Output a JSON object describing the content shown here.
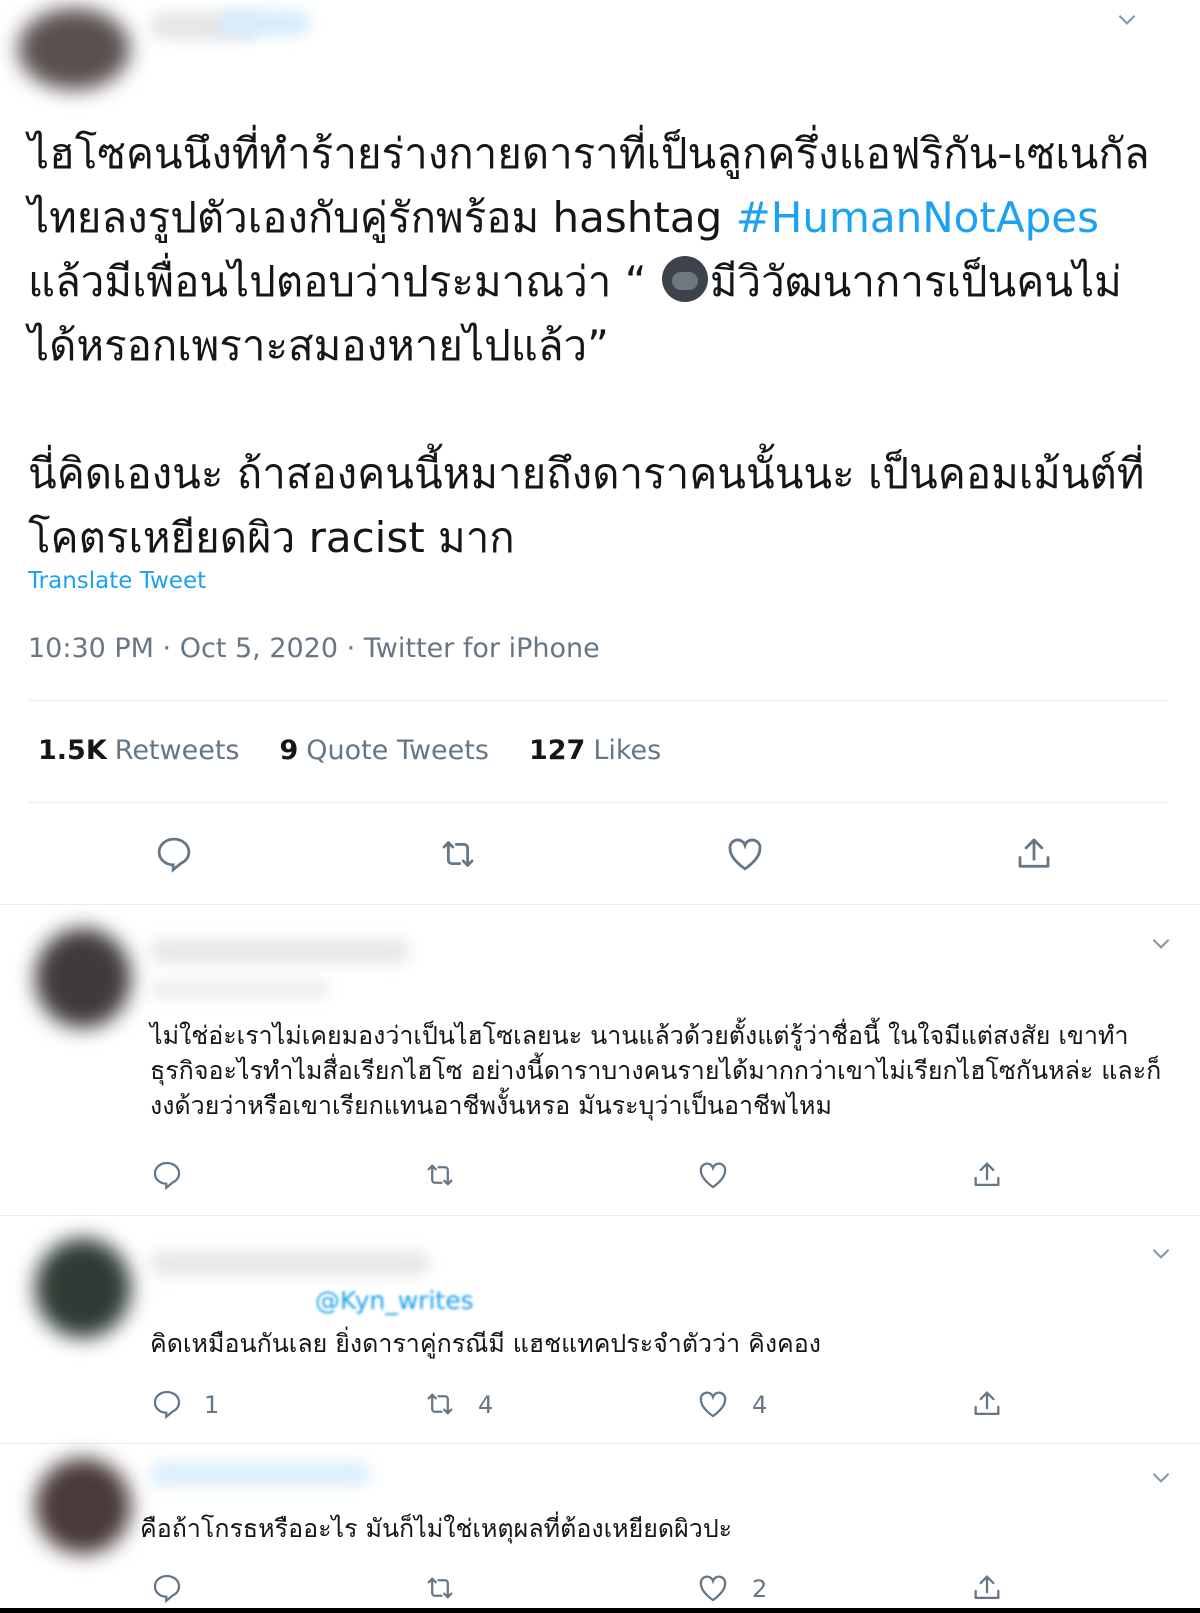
{
  "tweet": {
    "text": {
      "line_part1": "ไฮโซคนนึงที่ทำร้ายร่างกายดาราที่เป็นลูกครึ่งแอฟริกัน-เซเนกัล ไทยลงรูปตัวเองกับคู่รักพร้อม hashtag ",
      "hashtag": "#HumanNotApes",
      "line_part2": " แล้วมีเพื่อนไปตอบว่าประมาณว่า “ ",
      "line_part3": "มีวิวัฒนาการเป็นคนไม่ได้หรอกเพราะสมองหายไปแล้ว”",
      "paragraph2": "นี่คิดเองนะ ถ้าสองคนนี้หมายถึงดาราคนนั้นนะ เป็นคอมเม้นต์ที่โคตรเหยียดผิว racist มาก"
    },
    "translate_label": "Translate Tweet",
    "time": "10:30 PM · Oct 5, 2020 · Twitter for iPhone",
    "stats": [
      {
        "count": "1.5K",
        "label": "Retweets"
      },
      {
        "count": "9",
        "label": "Quote Tweets"
      },
      {
        "count": "127",
        "label": "Likes"
      }
    ],
    "icons": [
      "reply-icon",
      "retweet-icon",
      "like-icon",
      "share-icon"
    ]
  },
  "replies": [
    {
      "text": "ไม่ใช่อ่ะเราไม่เคยมองว่าเป็นไฮโซเลยนะ นานแล้วด้วยตั้งแต่รู้ว่าชื่อนี้ ในใจมีแต่สงสัย เขาทำธุรกิจอะไรทำไมสื่อเรียกไฮโซ อย่างนี้ดาราบางคนรายได้มากกว่าเขาไม่เรียกไฮโซกันหล่ะ และก็งงด้วยว่าหรือเขาเรียกแทนอาชีพงั้นหรอ มันระบุว่าเป็นอาชีพไหม",
      "reply_count": "",
      "retweet_count": "",
      "like_count": ""
    },
    {
      "replying_to": "@Kyn_writes",
      "text": "คิดเหมือนกันเลย ยิ่งดาราคู่กรณีมี แฮชแทคประจำตัวว่า คิงคอง",
      "reply_count": "1",
      "retweet_count": "4",
      "like_count": "4"
    },
    {
      "text": "คือถ้าโกรธหรืออะไร มันก็ไม่ใช่เหตุผลที่ต้องเหยียดผิวปะ",
      "reply_count": "",
      "retweet_count": "",
      "like_count": "2"
    }
  ],
  "colors": {
    "link": "#1da1f2",
    "secondary": "#657786",
    "divider": "#e6ecf0"
  }
}
